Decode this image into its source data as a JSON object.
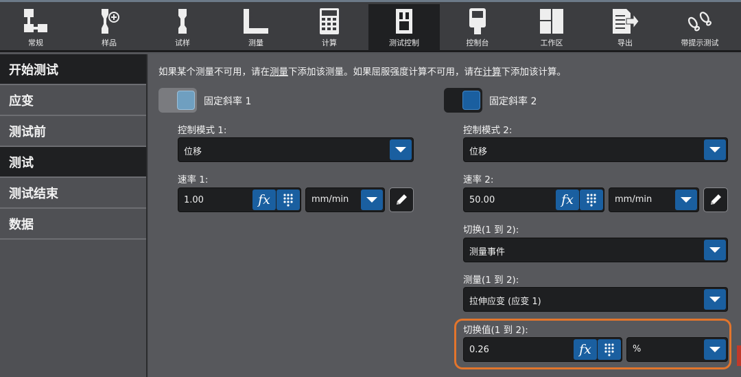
{
  "toolbar": {
    "items": [
      {
        "label": "常规",
        "icon": "flowchart-icon"
      },
      {
        "label": "样品",
        "icon": "specimen-icon"
      },
      {
        "label": "试样",
        "icon": "dogbone-icon"
      },
      {
        "label": "测量",
        "icon": "ruler-icon"
      },
      {
        "label": "计算",
        "icon": "calculator-icon"
      },
      {
        "label": "测试控制",
        "icon": "test-frame-icon"
      },
      {
        "label": "控制台",
        "icon": "console-icon"
      },
      {
        "label": "工作区",
        "icon": "workspace-icon"
      },
      {
        "label": "导出",
        "icon": "export-icon"
      },
      {
        "label": "带提示测试",
        "icon": "footprints-icon"
      }
    ],
    "active_index": 5
  },
  "sidebar": {
    "items": [
      {
        "label": "开始测试"
      },
      {
        "label": "应变"
      },
      {
        "label": "测试前"
      },
      {
        "label": "测试"
      },
      {
        "label": "测试结束"
      },
      {
        "label": "数据"
      }
    ],
    "active_labels": [
      "开始测试",
      "测试"
    ]
  },
  "main": {
    "info": {
      "p1": "如果某个测量不可用，请在",
      "link1": "测量",
      "p2": "下添加该测量。如果屈服强度计算不可用，请在",
      "link2": "计算",
      "p3": "下添加该计算。"
    },
    "ramp1": {
      "toggle_label": "固定斜率 1",
      "mode_label": "控制模式 1:",
      "mode_value": "位移",
      "rate_label": "速率 1:",
      "rate_value": "1.00",
      "rate_unit": "mm/min"
    },
    "ramp2": {
      "toggle_label": "固定斜率 2",
      "mode_label": "控制模式 2:",
      "mode_value": "位移",
      "rate_label": "速率 2:",
      "rate_value": "50.00",
      "rate_unit": "mm/min",
      "switch_label": "切换(1 到 2):",
      "switch_value": "测量事件",
      "measure_label": "测量(1 到 2):",
      "measure_value": "拉伸应变 (应变 1)",
      "switch_val_label": "切换值(1 到 2):",
      "switch_val_value": "0.26",
      "switch_val_unit": "%"
    },
    "fx_text": "fx"
  },
  "colors": {
    "accent_blue": "#1a5fa0",
    "highlight_orange": "#e3752c",
    "toggle_off_light": "#6f9fc0",
    "toggle_on_dark": "#1a5fa0"
  }
}
